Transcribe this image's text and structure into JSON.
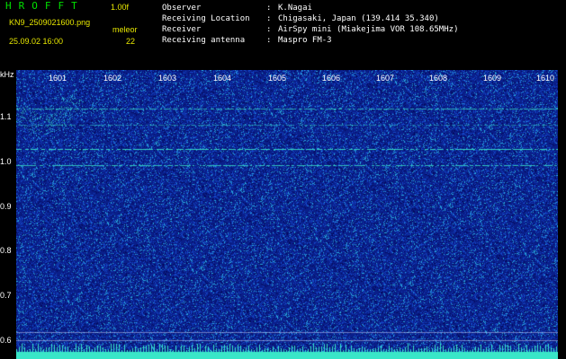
{
  "app": {
    "title": "HROFFT",
    "version": "1.00f",
    "filename": "KN9_2509021600.png",
    "mode_label": "meleor",
    "datetime": "25.09.02 16:00",
    "count": "22"
  },
  "station": {
    "rows": [
      {
        "label": "Observer",
        "sep": ":",
        "value": "K.Nagai"
      },
      {
        "label": "Receiving Location",
        "sep": ":",
        "value": "Chigasaki, Japan (139.414 35.340)"
      },
      {
        "label": "Receiver",
        "sep": ":",
        "value": "AirSpy mini (Miakejima VOR 108.65MHz)"
      },
      {
        "label": "Receiving antenna",
        "sep": ":",
        "value": "Maspro FM-3"
      }
    ]
  },
  "axes": {
    "y_unit": "kHz",
    "y_ticks": [
      "1.1",
      "1.0",
      "0.9",
      "0.8",
      "0.7",
      "0.6"
    ],
    "x_ticks": [
      "1601",
      "1602",
      "1603",
      "1604",
      "1605",
      "1606",
      "1607",
      "1608",
      "1609",
      "1610"
    ]
  },
  "colors": {
    "background": "#000000",
    "waterfall_base": "#0a1f8a",
    "signal": "#39e6c8",
    "header_green": "#00e000",
    "header_yellow": "#e6e600"
  }
}
